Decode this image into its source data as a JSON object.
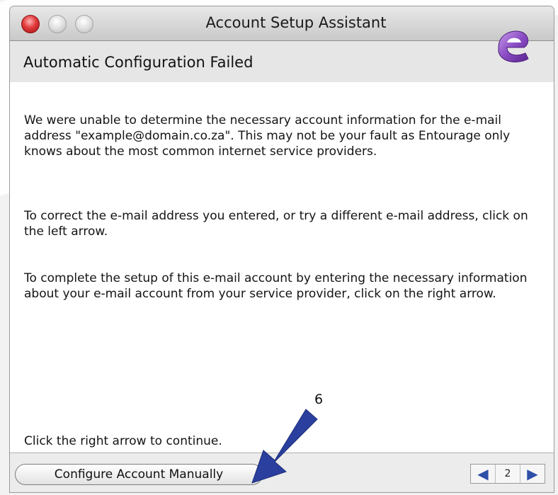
{
  "window": {
    "title": "Account Setup Assistant"
  },
  "header": {
    "title": "Automatic Configuration Failed",
    "logo_icon": "entourage-e-logo-icon"
  },
  "content": {
    "paragraph1": "We were unable to determine the necessary account information for the e-mail address \"example@domain.co.za\". This may not be your fault as Entourage only knows about the most common internet service providers.",
    "paragraph2": "To correct the e-mail address you entered, or try a different e-mail address, click on the left arrow.",
    "paragraph3": "To complete the setup of this e-mail account by entering the necessary information about your e-mail account from your service provider, click on the right arrow.",
    "continue_text": "Click the right arrow to continue."
  },
  "footer": {
    "configure_button_label": "Configure Account Manually",
    "page_number": "2",
    "prev_icon": "left-arrow-icon",
    "next_icon": "right-arrow-icon"
  },
  "annotation": {
    "number": "6",
    "color": "#2a3f9e"
  },
  "colors": {
    "close_button": "#e0393b",
    "arrow_accent": "#2d4fa8",
    "logo_purple": "#7a3fb0"
  }
}
